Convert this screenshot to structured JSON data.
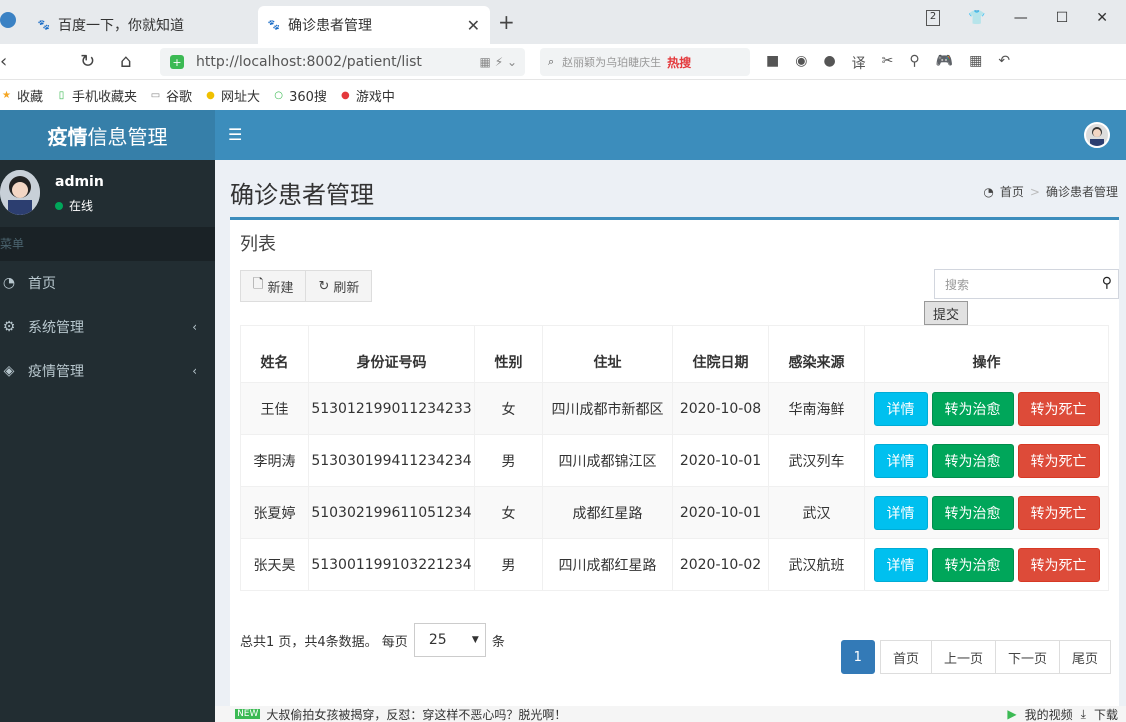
{
  "browser": {
    "tabs": [
      {
        "label": "百度一下，你就知道",
        "active": false
      },
      {
        "label": "确诊患者管理",
        "active": true
      }
    ],
    "url": "http://localhost:8002/patient/list",
    "search_placeholder": "赵丽颖为乌珀睫庆生",
    "search_hot": "热搜",
    "bookmarks": [
      "收藏",
      "手机收藏夹",
      "谷歌",
      "网址大",
      "360搜",
      "游戏中"
    ],
    "window_tab_count": "2"
  },
  "app": {
    "logo_bold": "疫情",
    "logo_rest": "信息管理"
  },
  "sidebar": {
    "user_name": "admin",
    "user_status": "在线",
    "header": "菜单",
    "items": [
      {
        "label": "首页",
        "icon": "dashboard-icon"
      },
      {
        "label": "系统管理",
        "icon": "gears-icon"
      },
      {
        "label": "疫情管理",
        "icon": "cube-icon"
      }
    ]
  },
  "page": {
    "title": "确诊患者管理",
    "breadcrumb_home": "首页",
    "breadcrumb_current": "确诊患者管理",
    "box_title": "列表",
    "new_button": "新建",
    "refresh_button": "刷新",
    "search_placeholder": "搜索",
    "submit_button": "提交"
  },
  "table": {
    "headers": [
      "姓名",
      "身份证号码",
      "性别",
      "住址",
      "住院日期",
      "感染来源",
      "操作"
    ],
    "rows": [
      {
        "name": "王佳",
        "id": "513012199011234233",
        "gender": "女",
        "address": "四川成都市新都区",
        "date": "2020-10-08",
        "source": "华南海鲜"
      },
      {
        "name": "李明涛",
        "id": "513030199411234234",
        "gender": "男",
        "address": "四川成都锦江区",
        "date": "2020-10-01",
        "source": "武汉列车"
      },
      {
        "name": "张夏婷",
        "id": "510302199611051234",
        "gender": "女",
        "address": "成都红星路",
        "date": "2020-10-01",
        "source": "武汉"
      },
      {
        "name": "张天昊",
        "id": "513001199103221234",
        "gender": "男",
        "address": "四川成都红星路",
        "date": "2020-10-02",
        "source": "武汉航班"
      }
    ],
    "action_detail": "详情",
    "action_cure": "转为治愈",
    "action_death": "转为死亡"
  },
  "pager": {
    "summary": "总共1 页，共4条数据。 每页",
    "page_size": "25",
    "unit": "条",
    "current": "1",
    "first": "首页",
    "prev": "上一页",
    "next": "下一页",
    "last": "尾页"
  },
  "statusbar": {
    "news_badge": "NEW",
    "news_text": "大叔偷拍女孩被揭穿，反怼：穿这样不恶心吗？脱光啊！",
    "video_label": "我的视频",
    "download_label": "下载"
  }
}
